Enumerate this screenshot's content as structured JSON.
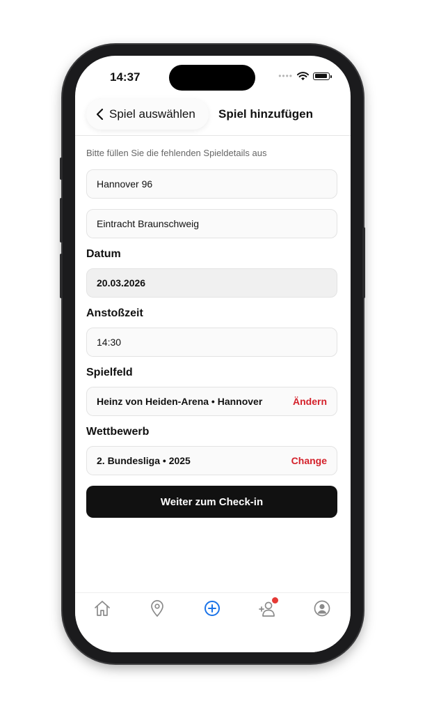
{
  "status_bar": {
    "time": "14:37"
  },
  "nav": {
    "back_label": "Spiel auswählen",
    "title": "Spiel hinzufügen"
  },
  "form": {
    "hint": "Bitte füllen Sie die fehlenden Spieldetails aus",
    "home_team": "Hannover 96",
    "away_team": "Eintracht Braunschweig",
    "date_label": "Datum",
    "date_value": "20.03.2026",
    "kickoff_label": "Anstoßzeit",
    "kickoff_value": "14:30",
    "venue_label": "Spielfeld",
    "venue_value": "Heinz von Heiden-Arena • Hannover",
    "venue_action": "Ändern",
    "competition_label": "Wettbewerb",
    "competition_value": "2. Bundesliga • 2025",
    "competition_action": "Change",
    "submit_label": "Weiter zum Check-in"
  },
  "tabbar": {
    "items": [
      {
        "icon": "home-icon",
        "active": false
      },
      {
        "icon": "map-pin-icon",
        "active": false
      },
      {
        "icon": "add-circle-icon",
        "active": true
      },
      {
        "icon": "add-friend-icon",
        "active": false,
        "badge": true
      },
      {
        "icon": "profile-icon",
        "active": false
      }
    ]
  },
  "colors": {
    "accent_red": "#d4212b",
    "active_tab": "#1a73e8",
    "inactive_tab": "#8a8a8a",
    "button_dark": "#111111"
  }
}
